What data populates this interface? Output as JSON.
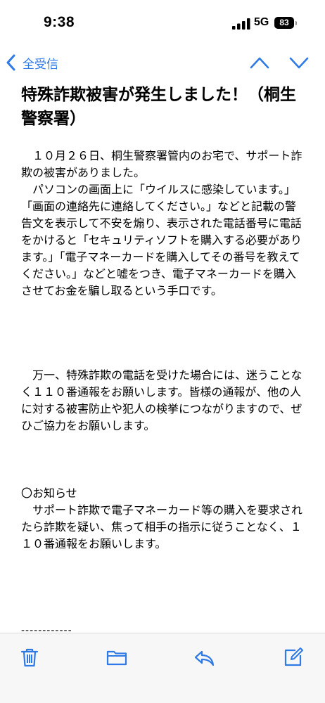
{
  "status_bar": {
    "time": "9:38",
    "network": "5G",
    "battery": "83"
  },
  "nav": {
    "back_label": "全受信",
    "icons": [
      "chevron-left-icon",
      "chevron-up-icon",
      "chevron-down-icon"
    ]
  },
  "message": {
    "subject": "特殊詐欺被害が発生しました！（桐生警察署）",
    "paragraphs": [
      "　１０月２６日、桐生警察署管内のお宅で、サポート詐欺の被害がありました。",
      "　パソコンの画面上に「ウイルスに感染しています。」「画面の連絡先に連絡してください。」などと記載の警告文を表示して不安を煽り、表示された電話番号に電話をかけると「セキュリティソフトを購入する必要があります。」「電子マネーカードを購入してその番号を教えてください。」などと嘘をつき、電子マネーカードを購入させてお金を騙し取るという手口です。",
      "　万一、特殊詐欺の電話を受けた場合には、迷うことなく１１０番通報をお願いします。皆様の通報が、他の人に対する被害防止や犯人の検挙につながりますので、ぜひご協力をお願いします。"
    ],
    "notice_heading": "〇お知らせ",
    "notice_body": "　サポート詐欺で電子マネーカード等の購入を要求されたら詐欺を疑い、焦って相手の指示に従うことなく、１１０番通報をお願いします。",
    "separator": "------------"
  },
  "toolbar": {
    "icons": [
      "trash-icon",
      "folder-icon",
      "reply-icon",
      "compose-icon"
    ]
  },
  "colors": {
    "accent": "#2f7ae5",
    "text": "#000000",
    "toolbar_bg": "#f7f7f7"
  }
}
